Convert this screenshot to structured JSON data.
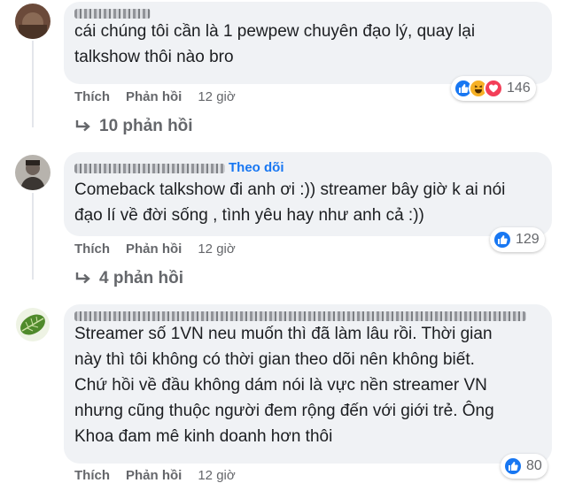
{
  "comments": [
    {
      "name_blurred": "Trần Duy Khải",
      "follow": "",
      "text": "cái chúng tôi cần là 1 pewpew chuyên đạo lý, quay lại\ntalkshow thôi nào bro",
      "like_label": "Thích",
      "reply_label": "Phản hồi",
      "time": "12 giờ",
      "reaction_icons": [
        "like-icon",
        "haha-icon",
        "love-icon"
      ],
      "reaction_count": "146",
      "replies": "10 phản hồi"
    },
    {
      "name_blurred": "Nguyễn Quang Huy",
      "follow": "Theo dõi",
      "text": "Comeback talkshow đi anh ơi :)) streamer bây giờ k ai nói\nđạo lí về đời sống , tình yêu hay như anh cả :))",
      "like_label": "Thích",
      "reply_label": "Phản hồi",
      "time": "12 giờ",
      "reaction_icons": [
        "like-icon"
      ],
      "reaction_count": "129",
      "replies": "4 phản hồi"
    },
    {
      "name_blurred": "Người tham gia ẩn danh",
      "follow": "",
      "text": "Streamer số 1VN neu muốn thì đã làm lâu rồi. Thời gian\nnày thì tôi không có thời gian theo dõi nên không biết.\nChứ hồi về đầu không dám nói là vực nền streamer VN\nnhưng cũng thuộc người đem rộng đến với giới trẻ. Ông\nKhoa đam mê kinh doanh hơn thôi",
      "like_label": "Thích",
      "reply_label": "Phản hồi",
      "time": "12 giờ",
      "reaction_icons": [
        "like-icon"
      ],
      "reaction_count": "80",
      "replies": ""
    }
  ],
  "colors": {
    "bubble": "#f0f2f5",
    "link": "#1877f2",
    "muted": "#65676b"
  }
}
